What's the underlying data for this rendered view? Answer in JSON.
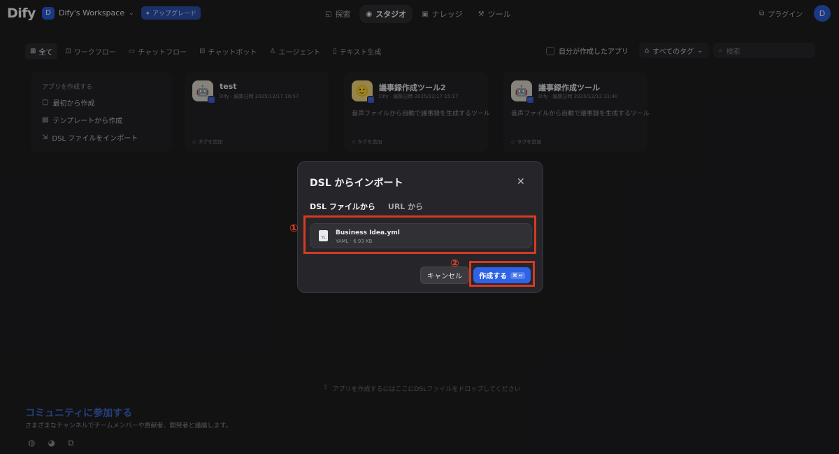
{
  "header": {
    "logo": "Dify",
    "workspace_initial": "D",
    "workspace_name": "Dify's Workspace",
    "upgrade_label": "アップグレード",
    "nav": [
      {
        "label": "探索",
        "icon": "compass-icon"
      },
      {
        "label": "スタジオ",
        "icon": "robot-icon"
      },
      {
        "label": "ナレッジ",
        "icon": "book-icon"
      },
      {
        "label": "ツール",
        "icon": "tool-icon"
      }
    ],
    "plugin_label": "プラグイン",
    "user_initial": "D"
  },
  "filters": {
    "items": [
      "全て",
      "ワークフロー",
      "チャットフロー",
      "チャットボット",
      "エージェント",
      "テキスト生成"
    ],
    "mine_label": "自分が作成したアプリ",
    "tag_select": "すべてのタグ",
    "search_placeholder": "検索"
  },
  "create_card": {
    "title": "アプリを作成する",
    "items": [
      "最初から作成",
      "テンプレートから作成",
      "DSL ファイルをインポート"
    ]
  },
  "apps": [
    {
      "name": "test",
      "meta": "Dify · 編集日時 2025/12/17 10:57",
      "desc": "",
      "tag": "タグを追加",
      "icon": "🤖"
    },
    {
      "name": "議事録作成ツール2",
      "meta": "Dify · 編集日時 2025/12/17 15:17",
      "desc": "音声ファイルから自動で議事録を生成するツール",
      "tag": "タグを追加",
      "icon": "🙂"
    },
    {
      "name": "議事録作成ツール",
      "meta": "Dify · 編集日時 2025/12/12 11:40",
      "desc": "音声ファイルから自動で議事録を生成するツール",
      "tag": "タグを追加",
      "icon": "🤖"
    }
  ],
  "drop_hint": "アプリを作成するにはここにDSLファイルをドロップしてください",
  "community": {
    "title": "コミュニティに参加する",
    "subtitle": "さまざまなチャンネルでチームメンバーや貢献者、開発者と議論します。"
  },
  "dialog": {
    "title": "DSL からインポート",
    "tabs": [
      "DSL ファイルから",
      "URL から"
    ],
    "file_name": "Business Idea.yml",
    "file_meta": "YAML · 6.93 KB",
    "cancel_label": "キャンセル",
    "create_label": "作成する",
    "shortcut": "⌘ ↵"
  },
  "annotations": {
    "one": "①",
    "two": "②"
  },
  "colors": {
    "accent": "#2f62e6",
    "annotation": "#d53a22"
  }
}
